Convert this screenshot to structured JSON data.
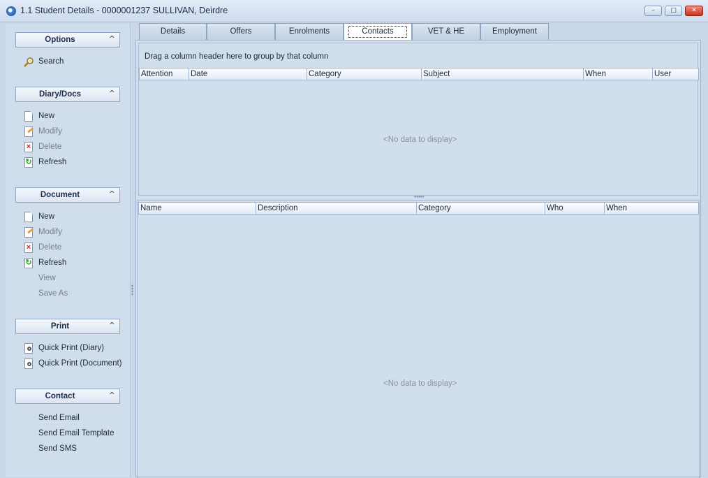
{
  "window": {
    "title": "1.1 Student Details - 0000001237  SULLIVAN, Deirdre",
    "controls": {
      "minimize": "–",
      "maximize": "□",
      "close": "✕"
    }
  },
  "sidebar": {
    "groups": [
      {
        "title": "Options",
        "items": [
          {
            "label": "Search",
            "icon": "search-icon"
          }
        ]
      },
      {
        "title": "Diary/Docs",
        "items": [
          {
            "label": "New",
            "icon": "new-document-icon"
          },
          {
            "label": "Modify",
            "icon": "modify-document-icon"
          },
          {
            "label": "Delete",
            "icon": "delete-icon"
          },
          {
            "label": "Refresh",
            "icon": "refresh-icon"
          }
        ]
      },
      {
        "title": "Document",
        "items": [
          {
            "label": "New",
            "icon": "new-document-icon"
          },
          {
            "label": "Modify",
            "icon": "modify-document-icon"
          },
          {
            "label": "Delete",
            "icon": "delete-icon"
          },
          {
            "label": "Refresh",
            "icon": "refresh-icon"
          },
          {
            "label": "View"
          },
          {
            "label": "Save As"
          }
        ]
      },
      {
        "title": "Print",
        "items": [
          {
            "label": "Quick Print (Diary)",
            "icon": "print-preview-icon"
          },
          {
            "label": "Quick Print (Document)",
            "icon": "print-preview-icon"
          }
        ]
      },
      {
        "title": "Contact",
        "items": [
          {
            "label": "Send Email"
          },
          {
            "label": "Send Email Template"
          },
          {
            "label": "Send SMS"
          }
        ]
      }
    ],
    "collapse_glyph": "^"
  },
  "tabs": [
    {
      "label": "Details"
    },
    {
      "label": "Offers"
    },
    {
      "label": "Enrolments"
    },
    {
      "label": "Contacts"
    },
    {
      "label": "VET & HE"
    },
    {
      "label": "Employment"
    }
  ],
  "active_tab": "Contacts",
  "contacts": {
    "group_hint": "Drag a column header here to group by that column",
    "upper_grid": {
      "columns": [
        "Attention",
        "Date",
        "Category",
        "Subject",
        "When",
        "User"
      ],
      "empty_text": "<No data to display>"
    },
    "lower_grid": {
      "columns": [
        "Name",
        "Description",
        "Category",
        "Who",
        "When"
      ],
      "empty_text": "<No data to display>"
    }
  },
  "colors": {
    "background": "#c9d7e8",
    "panel": "#d1deed",
    "header_border": "#8fa6c5"
  }
}
